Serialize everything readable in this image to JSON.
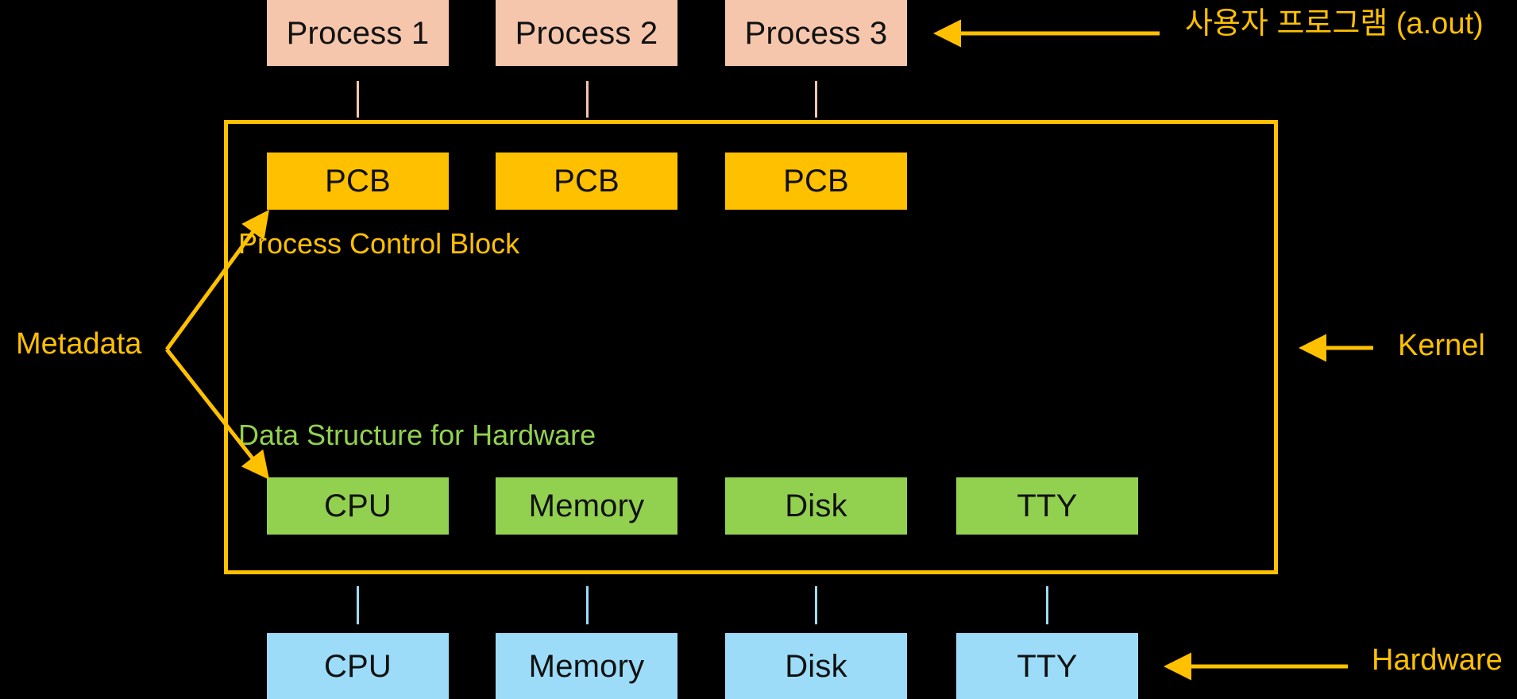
{
  "diagram": {
    "title": "Operating System Kernel Structure Diagram",
    "background_color": "#000000",
    "colors": {
      "process_box": "#F5C6AC",
      "pcb_box": "#FFC000",
      "hardware_struct_box": "#92D14F",
      "hardware_box": "#9CDCF8",
      "kernel_border": "#FFC000",
      "amber_text": "#FFC000",
      "green_text": "#92D14F",
      "box_text": "#111111"
    }
  },
  "processes": {
    "items": [
      {
        "label": "Process 1"
      },
      {
        "label": "Process 2"
      },
      {
        "label": "Process 3"
      }
    ]
  },
  "pcb_row": {
    "caption": "Process Control Block",
    "items": [
      {
        "label": "PCB"
      },
      {
        "label": "PCB"
      },
      {
        "label": "PCB"
      }
    ]
  },
  "hardware_struct_row": {
    "caption": "Data Structure for Hardware",
    "items": [
      {
        "label": "CPU"
      },
      {
        "label": "Memory"
      },
      {
        "label": "Disk"
      },
      {
        "label": "TTY"
      }
    ]
  },
  "hardware_row": {
    "items": [
      {
        "label": "CPU"
      },
      {
        "label": "Memory"
      },
      {
        "label": "Disk"
      },
      {
        "label": "TTY"
      }
    ]
  },
  "annotations": {
    "user_program": "사용자 프로그램 (a.out)",
    "kernel": "Kernel",
    "hardware": "Hardware",
    "metadata": "Metadata"
  }
}
